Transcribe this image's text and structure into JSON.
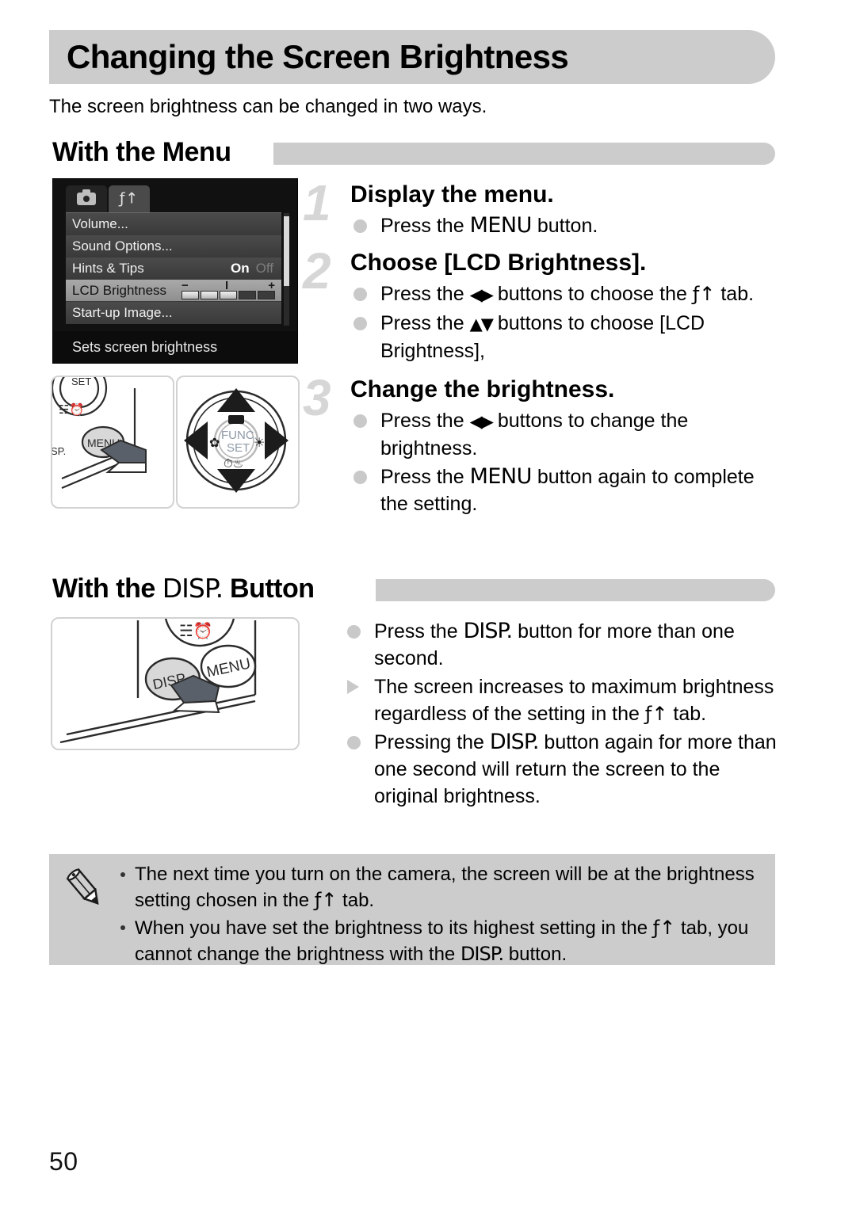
{
  "page": {
    "number": "50",
    "title": "Changing the Screen Brightness",
    "intro": "The screen brightness can be changed in two ways."
  },
  "sections": [
    {
      "id": "menu",
      "heading": "With the Menu"
    },
    {
      "id": "disp",
      "heading_prefix": "With the ",
      "heading_glyph": "DISP.",
      "heading_suffix": " Button"
    }
  ],
  "lcd_screen": {
    "tabs": [
      {
        "icon": "camera-icon",
        "active": false
      },
      {
        "icon": "tools-icon",
        "glyph": "ƒ↑",
        "active": true
      }
    ],
    "rows": [
      {
        "label": "Volume...",
        "value": "",
        "selected": false
      },
      {
        "label": "Sound Options...",
        "value": "",
        "selected": false
      },
      {
        "label": "Hints & Tips",
        "value_on": "On",
        "value_off": "Off",
        "selected": false
      },
      {
        "label": "LCD Brightness",
        "slider": true,
        "selected": true
      },
      {
        "label": "Start-up Image...",
        "value": "",
        "selected": false
      }
    ],
    "slider": {
      "minus_label": "−",
      "mid_label": "I",
      "plus_label": "+",
      "segments_total": 5,
      "segments_filled": 3
    },
    "hint": "Sets screen brightness"
  },
  "photos": [
    {
      "name": "menu-button-photo",
      "labels": [
        "SET",
        "MENU",
        "SP."
      ]
    },
    {
      "name": "direction-pad-photo",
      "labels": [
        "FUNC.",
        "SET"
      ]
    },
    {
      "name": "disp-button-photo",
      "labels": [
        "DISP.",
        "MENU"
      ]
    }
  ],
  "steps": [
    {
      "number": "1",
      "title": "Display the menu.",
      "lines": [
        {
          "marker": "bullet",
          "pre": "Press the ",
          "key": "MENU",
          "key_style": "menu",
          "post": " button."
        }
      ]
    },
    {
      "number": "2",
      "title": "Choose [LCD Brightness].",
      "lines": [
        {
          "marker": "bullet",
          "pre": "Press the ",
          "key": "◀▶",
          "key_style": "arrow",
          "post": " buttons to choose the ",
          "key2": "ƒ↑",
          "key2_style": "tool",
          "post2": " tab."
        },
        {
          "marker": "bullet",
          "pre": "Press the ",
          "key": "▲▼",
          "key_style": "arrow",
          "post": " buttons to choose [LCD Brightness],"
        }
      ]
    },
    {
      "number": "3",
      "title": "Change the brightness.",
      "lines": [
        {
          "marker": "bullet",
          "pre": "Press the ",
          "key": "◀▶",
          "key_style": "arrow",
          "post": " buttons to change the brightness."
        },
        {
          "marker": "bullet",
          "pre": "Press the ",
          "key": "MENU",
          "key_style": "menu",
          "post": " button again to complete the setting."
        }
      ]
    }
  ],
  "disp_section_lines": [
    {
      "marker": "bullet",
      "pre": "Press the ",
      "key": "DISP.",
      "key_style": "disp",
      "post": " button for more than one second."
    },
    {
      "marker": "triangle",
      "pre": "The screen increases to maximum brightness regardless of the setting in the ",
      "key": "ƒ↑",
      "key_style": "tool",
      "post": " tab."
    },
    {
      "marker": "bullet",
      "pre": "Pressing the ",
      "key": "DISP.",
      "key_style": "disp",
      "post": " button again for more than one second will return the screen to the original brightness."
    }
  ],
  "note": {
    "icon": "pencil-icon",
    "items": [
      {
        "pre": "The next time you turn on the camera, the screen will be at the brightness setting chosen in the ",
        "key": "ƒ↑",
        "key_style": "tool",
        "post": " tab."
      },
      {
        "pre": "When you have set the brightness to its highest setting in the ",
        "key": "ƒ↑",
        "key_style": "tool",
        "post": " tab, you cannot change the brightness with the ",
        "key2": "DISP.",
        "key2_style": "disp",
        "post2": " button."
      }
    ]
  },
  "colors": {
    "bar_gray": "#cccccc",
    "step_number_gray": "#d6d6d6",
    "bullet_gray": "#c9c9c9",
    "lcd_dark": "#111111"
  }
}
